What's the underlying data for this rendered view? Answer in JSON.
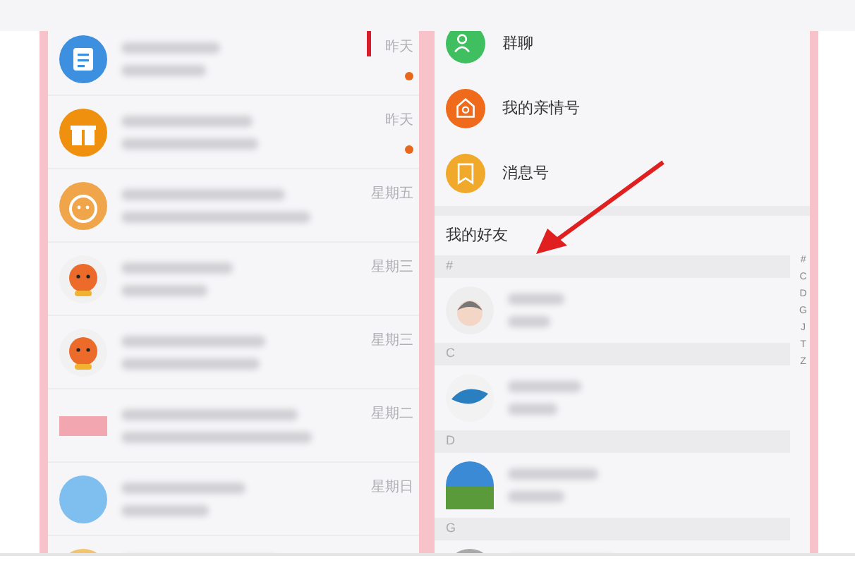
{
  "chats": [
    {
      "time": "昨天",
      "unread": true
    },
    {
      "time": "昨天",
      "unread": true
    },
    {
      "time": "星期五",
      "unread": false
    },
    {
      "time": "星期三",
      "unread": false
    },
    {
      "time": "星期三",
      "unread": false
    },
    {
      "time": "星期二",
      "unread": false
    },
    {
      "time": "星期日",
      "unread": false
    },
    {
      "unread": false
    }
  ],
  "contact_menu": [
    {
      "label": "群聊"
    },
    {
      "label": "我的亲情号"
    },
    {
      "label": "消息号"
    }
  ],
  "friends_header": "我的好友",
  "friend_groups": [
    {
      "letter": "#"
    },
    {
      "letter": "C"
    },
    {
      "letter": "D"
    },
    {
      "letter": "G"
    }
  ],
  "index_letters": [
    "#",
    "C",
    "D",
    "G",
    "J",
    "T",
    "Z"
  ]
}
